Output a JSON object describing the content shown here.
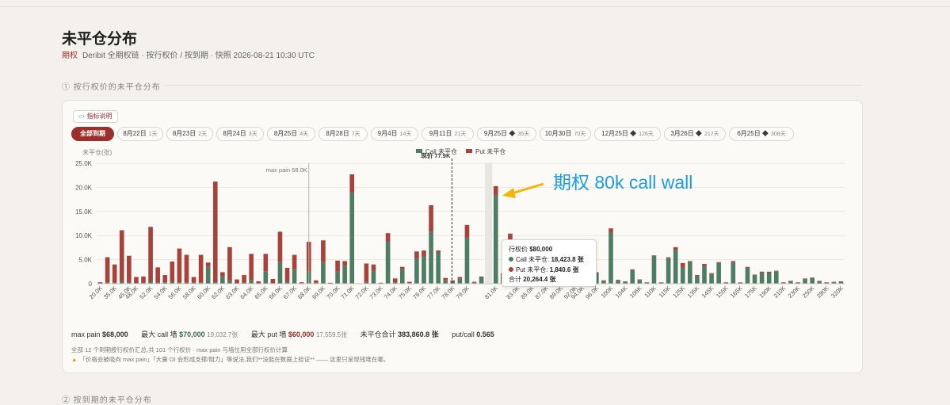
{
  "page": {
    "title": "未平仓分布",
    "subtitle_tag": "期权",
    "subtitle": "Deribit 全期权链 · 按行权价 / 按到期 · 快照 2026-08-21 10:30 UTC",
    "section1": "① 按行权价的未平仓分布",
    "section2": "② 按到期的未平仓分布"
  },
  "legend_button": {
    "icon": "book-icon",
    "label": "指标说明"
  },
  "tabs": [
    {
      "label": "全部到期",
      "days": "",
      "active": true
    },
    {
      "label": "8月22日",
      "days": "1天"
    },
    {
      "label": "8月23日",
      "days": "2天"
    },
    {
      "label": "8月24日",
      "days": "3天"
    },
    {
      "label": "8月25日",
      "days": "4天"
    },
    {
      "label": "8月28日",
      "days": "7天"
    },
    {
      "label": "9月4日",
      "days": "14天"
    },
    {
      "label": "9月11日",
      "days": "21天"
    },
    {
      "label": "9月25日 ◆",
      "days": "35天"
    },
    {
      "label": "10月30日",
      "days": "70天"
    },
    {
      "label": "12月25日 ◆",
      "days": "126天"
    },
    {
      "label": "3月26日 ◆",
      "days": "217天"
    },
    {
      "label": "6月25日 ◆",
      "days": "308天"
    }
  ],
  "colors": {
    "call": "#4e7d63",
    "put": "#a8433c",
    "accent": "#9b2f2b",
    "annotation": "#1f9be0",
    "arrow": "#f4b400"
  },
  "chart_data": {
    "type": "bar",
    "stacked": true,
    "ylabel": "未平仓(张)",
    "ylim": [
      0,
      25000
    ],
    "yticks": [
      "0",
      "5.0K",
      "10.0K",
      "15.0K",
      "20.0K",
      "25.0K"
    ],
    "legend": {
      "call": "Call 未平仓",
      "put": "Put 未平仓"
    },
    "categories": [
      "20.0K",
      "30.0K",
      "35.0K",
      "40.0K",
      "45.0K",
      "48.0K",
      "50.0K",
      "52.0K",
      "53.0K",
      "54.0K",
      "55.0K",
      "56.0K",
      "57.0K",
      "58.0K",
      "59.0K",
      "60.0K",
      "61.0K",
      "62.0K",
      "62.5K",
      "63.0K",
      "63.5K",
      "64.0K",
      "64.5K",
      "65.0K",
      "65.5K",
      "66.0K",
      "66.5K",
      "67.0K",
      "67.5K",
      "68.0K",
      "68.5K",
      "69.0K",
      "69.5K",
      "70.0K",
      "70.5K",
      "71.0K",
      "71.5K",
      "72.0K",
      "72.5K",
      "73.0K",
      "73.5K",
      "74.0K",
      "74.5K",
      "75.0K",
      "75.5K",
      "76.0K",
      "76.5K",
      "77.0K",
      "77.5K",
      "78.0K",
      "78.5K",
      "79.0K",
      "79.5K",
      "80.0K",
      "80.5K",
      "81.0K",
      "81.5K",
      "82.0K",
      "83.0K",
      "84.0K",
      "85.0K",
      "86.0K",
      "87.0K",
      "88.0K",
      "89.0K",
      "90.0K",
      "92.0K",
      "94.0K",
      "95.0K",
      "96.0K",
      "98.0K",
      "100K",
      "102K",
      "104K",
      "105K",
      "106K",
      "108K",
      "110K",
      "112K",
      "115K",
      "120K",
      "125K",
      "130K",
      "135K",
      "140K",
      "145K",
      "150K",
      "155K",
      "160K",
      "165K",
      "170K",
      "175K",
      "180K",
      "190K",
      "200K",
      "210K",
      "220K",
      "230K",
      "240K",
      "250K",
      "260K",
      "280K",
      "300K",
      "320K"
    ],
    "tick_labels": [
      "20.0K",
      "35.0K",
      "45.0K",
      "48.0K",
      "52.0K",
      "54.0K",
      "56.0K",
      "58.0K",
      "60.0K",
      "62.0K",
      "63.0K",
      "64.0K",
      "65.0K",
      "66.0K",
      "67.0K",
      "68.0K",
      "69.0K",
      "70.0K",
      "71.0K",
      "72.0K",
      "73.0K",
      "74.0K",
      "75.0K",
      "76.0K",
      "77.0K",
      "78.0K",
      "79.0K",
      "81.0K",
      "83.0K",
      "85.0K",
      "87.0K",
      "89.0K",
      "92.0K",
      "94.0K",
      "96.0K",
      "100K",
      "104K",
      "106K",
      "110K",
      "115K",
      "125K",
      "135K",
      "145K",
      "155K",
      "165K",
      "175K",
      "190K",
      "210K",
      "230K",
      "250K",
      "280K",
      "320K"
    ],
    "series": [
      {
        "name": "Call 未平仓",
        "values": [
          0,
          300,
          200,
          500,
          400,
          100,
          200,
          500,
          200,
          300,
          400,
          300,
          200,
          200,
          300,
          3500,
          300,
          1500,
          600,
          0,
          200,
          800,
          0,
          2600,
          100,
          4500,
          500,
          3000,
          0,
          2500,
          200,
          4500,
          0,
          2500,
          3800,
          18900,
          0,
          400,
          2800,
          0,
          8800,
          300,
          3000,
          100,
          5200,
          5600,
          10800,
          6500,
          700,
          400,
          1100,
          9500,
          200,
          1400,
          0,
          18423.8,
          1700,
          9000,
          2400,
          1500,
          2600,
          1000,
          2500,
          200,
          3000,
          1400,
          5000,
          400,
          3000,
          2200,
          500,
          10700,
          600,
          400,
          2900,
          800,
          200,
          5800,
          200,
          5300,
          7000,
          3300,
          4600,
          1500,
          3600,
          2000,
          4400,
          200,
          4400,
          200,
          3300,
          1800,
          2200,
          2300,
          2600,
          200,
          500,
          200,
          1000,
          1200,
          500,
          200,
          300,
          400
        ]
      },
      {
        "name": "Put 未平仓",
        "values": [
          300,
          5200,
          3800,
          10600,
          5400,
          1300,
          1300,
          11300,
          3200,
          1500,
          4200,
          7000,
          5800,
          1200,
          5700,
          900,
          20900,
          900,
          7000,
          900,
          1600,
          5400,
          500,
          3600,
          900,
          6300,
          2800,
          3000,
          300,
          6200,
          500,
          4500,
          200,
          2300,
          900,
          3800,
          100,
          3800,
          1200,
          200,
          1700,
          800,
          500,
          300,
          1500,
          1300,
          5500,
          400,
          500,
          300,
          300,
          2700,
          200,
          100,
          0,
          1840.6,
          500,
          1400,
          500,
          400,
          300,
          200,
          400,
          200,
          500,
          0,
          500,
          300,
          300,
          200,
          200,
          800,
          200,
          100,
          100,
          100,
          100,
          100,
          100,
          200,
          600,
          1000,
          100,
          300,
          500,
          200,
          100,
          100,
          300,
          100,
          200,
          100,
          300,
          200,
          100,
          100,
          100,
          100,
          100,
          100,
          100,
          100,
          100,
          100
        ]
      }
    ],
    "markers": {
      "max_pain_label": "max pain 68.0K",
      "spot_label": "现价 77.9K"
    },
    "tooltip": {
      "title_label": "行权价",
      "title_value": "$80,000",
      "call_label": "Call 未平仓:",
      "call_value": "18,423.8 张",
      "put_label": "Put 未平仓:",
      "put_value": "1,840.6 张",
      "total_label": "合计",
      "total_value": "20,264.4 张"
    }
  },
  "stats": {
    "max_pain_label": "max pain",
    "max_pain_value": "$68,000",
    "max_call_label": "最大 call 墙",
    "max_call_value": "$70,000",
    "max_call_sub": "19,032.7张",
    "max_put_label": "最大 put 墙",
    "max_put_value": "$60,000",
    "max_put_sub": "17,559.5张",
    "total_label": "未平仓合计",
    "total_value": "383,860.8 张",
    "pc_label": "put/call",
    "pc_value": "0.565"
  },
  "notes": {
    "line1": "全部 12 个到期按行权价汇总,共 101 个行权价 · max pain 与墙位用全部行权价计算",
    "line2": "「价格会被吸向 max pain」「大量 OI 会形成支撑/阻力」等说法,我们**没能在数据上验证** —— 这里只呈现钱堆在哪。"
  },
  "annotation": "期权 80k call wall"
}
